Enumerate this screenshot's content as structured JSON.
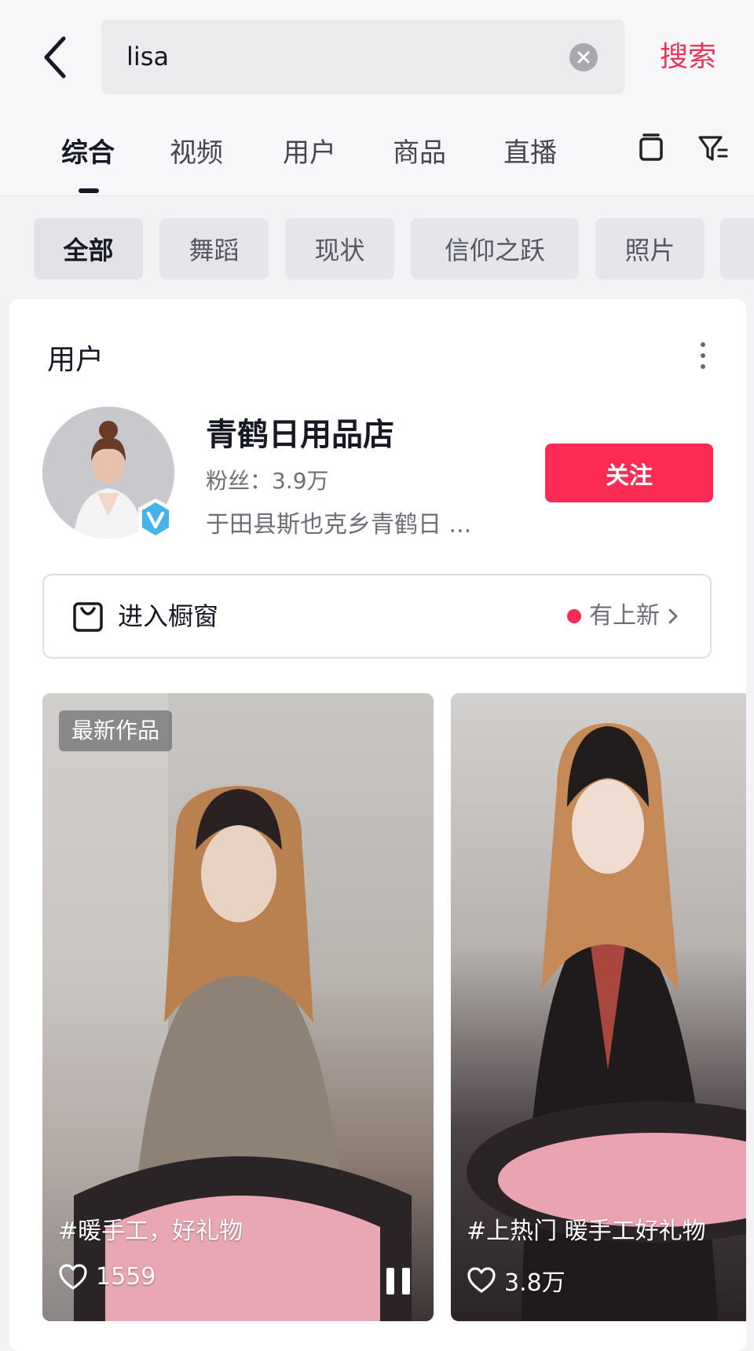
{
  "header": {
    "search_value": "lisa",
    "search_button": "搜索"
  },
  "tabs": [
    "综合",
    "视频",
    "用户",
    "商品",
    "直播"
  ],
  "filter_chips": [
    "全部",
    "舞蹈",
    "现状",
    "信仰之跃",
    "照片"
  ],
  "user_section": {
    "title": "用户",
    "user": {
      "name": "青鹤日用品店",
      "fans": "粉丝：3.9万",
      "bio": "于田县斯也克乡青鹤日 ...",
      "follow_label": "关注"
    },
    "showcase": {
      "label": "进入橱窗",
      "status": "有上新"
    }
  },
  "videos": [
    {
      "badge": "最新作品",
      "caption": "#暖手工，好礼物",
      "likes": "1559"
    },
    {
      "caption": "#上热门 暖手工好礼物",
      "likes": "3.8万"
    }
  ],
  "colors": {
    "accent": "#fe2c55",
    "search_button": "#e8365a"
  }
}
